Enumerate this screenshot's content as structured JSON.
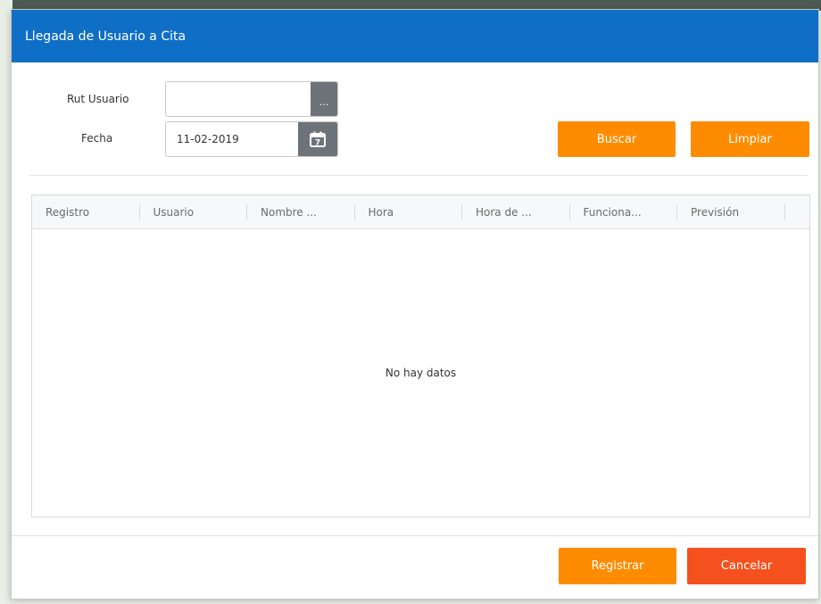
{
  "dialog": {
    "title": "Llegada de Usuario a Cita"
  },
  "form": {
    "rut_label": "Rut Usuario",
    "rut_value": "",
    "rut_button_label": "...",
    "fecha_label": "Fecha",
    "fecha_value": "11-02-2019",
    "calendar_day": "7"
  },
  "actions": {
    "search_label": "Buscar",
    "clear_label": "Limpiar",
    "register_label": "Registrar",
    "cancel_label": "Cancelar"
  },
  "grid": {
    "columns": [
      "Registro",
      "Usuario",
      "Nombre ...",
      "Hora",
      "Hora de ...",
      "Funciona...",
      "Previsión"
    ],
    "empty_text": "No hay datos"
  },
  "colors": {
    "header": "#0f6fc6",
    "primary_button": "#ff8c00",
    "cancel_button": "#f4511e",
    "input_button": "#6d7378"
  },
  "icons": {
    "rut_picker": "ellipsis-icon",
    "date_picker": "calendar-icon"
  }
}
